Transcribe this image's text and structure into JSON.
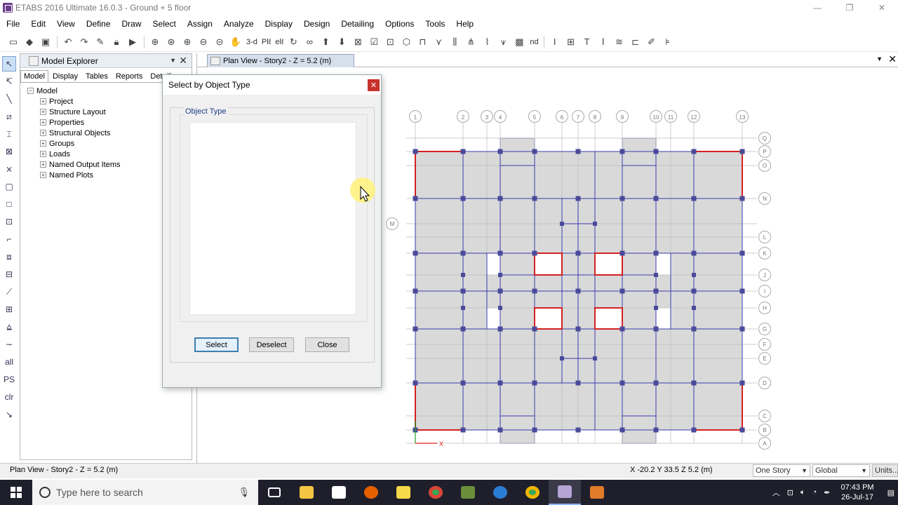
{
  "window": {
    "title": "ETABS 2016 Ultimate 16.0.3 - Ground + 5 floor",
    "minimize": "—",
    "restore": "❐",
    "close": "✕"
  },
  "menu": [
    "File",
    "Edit",
    "View",
    "Define",
    "Draw",
    "Select",
    "Assign",
    "Analyze",
    "Display",
    "Design",
    "Detailing",
    "Options",
    "Tools",
    "Help"
  ],
  "toolbar": {
    "view_3d": "3-d",
    "plan": "Plℓ",
    "elev": "elℓ",
    "nd": "nd"
  },
  "left_tools": {
    "all": "all",
    "ps": "PS",
    "clr": "clr"
  },
  "explorer": {
    "title": "Model Explorer",
    "tabs": [
      "Model",
      "Display",
      "Tables",
      "Reports",
      "Detailin"
    ],
    "root": "Model",
    "items": [
      "Project",
      "Structure Layout",
      "Properties",
      "Structural Objects",
      "Groups",
      "Loads",
      "Named Output Items",
      "Named Plots"
    ]
  },
  "plan_view": {
    "tab_title": "Plan View - Story2 - Z = 5.2 (m)",
    "grid_x_labels": [
      "1",
      "2",
      "3",
      "4",
      "5",
      "6",
      "7",
      "8",
      "9",
      "10",
      "11",
      "12",
      "13"
    ],
    "grid_y_labels": [
      "Q",
      "P",
      "O",
      "N",
      "M",
      "L",
      "K",
      "J",
      "I",
      "H",
      "G",
      "F",
      "E",
      "D",
      "C",
      "B",
      "A"
    ],
    "axis_x": "X"
  },
  "dialog": {
    "title": "Select by Object Type",
    "group_label": "Object Type",
    "select_label": "Select",
    "deselect_label": "Deselect",
    "close_label": "Close"
  },
  "status": {
    "left": "Plan View - Story2 - Z = 5.2 (m)",
    "coords": "X -20.2  Y 33.5  Z 5.2 (m)",
    "story_mode": "One Story",
    "coord_system": "Global",
    "units": "Units..."
  },
  "taskbar": {
    "search_placeholder": "Type here to search",
    "time": "07:43 PM",
    "date": "26-Jul-17"
  },
  "colors": {
    "beam": "#3b3bb0",
    "wall": "#d42020",
    "slab": "#d9d9d9",
    "column": "#4a4a9a",
    "grid": "#bbbbbb"
  }
}
